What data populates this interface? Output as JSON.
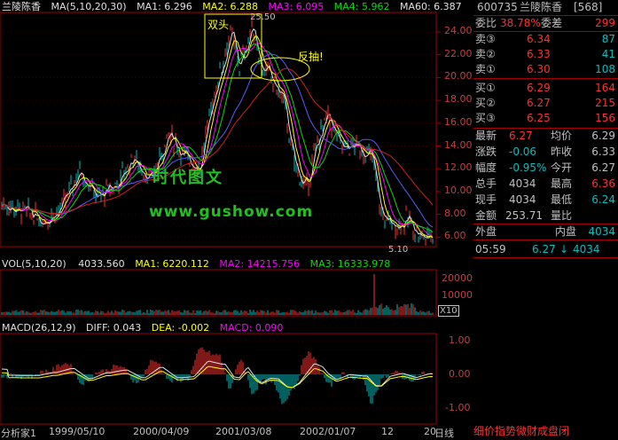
{
  "stock": {
    "code": "600735",
    "name": "兰陵陈香",
    "num": "[568]"
  },
  "main_header": {
    "name": "兰陵陈香",
    "ma_params": "MA(5,10,20,30)",
    "ma1": "MA1: 6.296",
    "ma2": "MA2: 6.288",
    "ma3": "MA3: 6.095",
    "ma4": "MA4: 5.962",
    "ma60": "MA60: 6.387"
  },
  "annotations": {
    "double_top": "双头",
    "peak_price": "25.50",
    "rebound": "反抽!",
    "watermark1": "时代图文",
    "watermark2": "www.gushow.com",
    "low_price": "5.10"
  },
  "price_axis": [
    "24.00",
    "22.00",
    "20.00",
    "18.00",
    "16.00",
    "14.00",
    "12.00",
    "10.00",
    "8.00",
    "6.00"
  ],
  "vol_header": {
    "label": "VOL(5,10,20)",
    "vol": "4033.560",
    "ma1": "MA1: 6220.112",
    "ma2": "MA2: 14215.756",
    "ma3": "MA3: 16333.978"
  },
  "vol_axis": [
    "20000",
    "10000"
  ],
  "vol_unit": "X10",
  "macd_header": {
    "label": "MACD(26,12,9)",
    "diff": "DIFF: 0.043",
    "dea": "DEA: -0.002",
    "macd": "MACD: 0.090"
  },
  "macd_axis": [
    "1.00",
    "0.00",
    "-1.00"
  ],
  "date_axis": {
    "left_label": "分析家1",
    "dates": [
      "1999/05/10",
      "2000/04/09",
      "2001/03/08",
      "2002/01/07",
      "12",
      "20"
    ],
    "period": "日线"
  },
  "quote": {
    "weibi_label": "委比",
    "weibi_val": "38.78%",
    "weicha_label": "委差",
    "weicha_val": "299",
    "asks": [
      {
        "label": "卖③",
        "price": "6.34",
        "vol": "87"
      },
      {
        "label": "卖②",
        "price": "6.33",
        "vol": "41"
      },
      {
        "label": "卖①",
        "price": "6.30",
        "vol": "108"
      }
    ],
    "bids": [
      {
        "label": "买①",
        "price": "6.29",
        "vol": "164"
      },
      {
        "label": "买②",
        "price": "6.27",
        "vol": "215"
      },
      {
        "label": "买③",
        "price": "6.25",
        "vol": "156"
      }
    ],
    "rows": [
      {
        "l1": "最新",
        "v1": "6.27",
        "l2": "均价",
        "v2": "6.29"
      },
      {
        "l1": "涨跌",
        "v1": "-0.06",
        "l2": "昨收",
        "v2": "6.33"
      },
      {
        "l1": "幅度",
        "v1": "-0.95%",
        "l2": "今开",
        "v2": "6.27"
      },
      {
        "l1": "总手",
        "v1": "4034",
        "l2": "最高",
        "v2": "6.36"
      },
      {
        "l1": "现手",
        "v1": "4034",
        "l2": "最低",
        "v2": "6.24"
      }
    ],
    "amount_label": "金额",
    "amount_val": "253.71",
    "liangbi_label": "量比",
    "waipan_label": "外盘",
    "neipan_label": "内盘",
    "neipan_val": "4034",
    "tick_time": "05:59",
    "tick_price": "6.27",
    "tick_arrow": "↓",
    "tick_vol": "4034"
  },
  "tabs": "细价指势微财成盘闭"
}
